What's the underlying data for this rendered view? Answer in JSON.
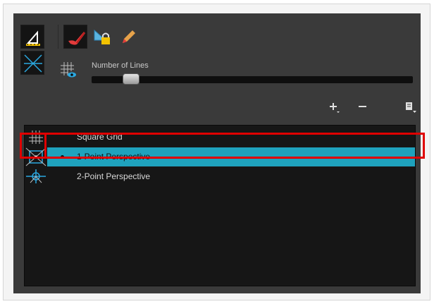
{
  "panel": {
    "accent_color": "#1fa2bd",
    "highlight_color": "#e00000",
    "tools": [
      {
        "name": "perspective-tool-icon",
        "selected": true
      },
      {
        "name": "brush-icon",
        "selected": true
      },
      {
        "name": "lock-ruler-icon",
        "selected": false
      },
      {
        "name": "pencil-icon",
        "selected": false
      },
      {
        "name": "vanishing-point-icon",
        "selected": true
      },
      {
        "name": "grid-visibility-icon",
        "selected": false
      }
    ],
    "slider": {
      "label": "Number of Lines",
      "value_fraction": 0.1
    },
    "actions": {
      "add": "+",
      "remove": "−",
      "menu": "menu-icon"
    }
  },
  "guides": [
    {
      "label": "Square Grid",
      "icon": "square-grid-icon",
      "selected": false,
      "active": false
    },
    {
      "label": "1-Point Perspective",
      "icon": "one-point-perspective-icon",
      "selected": true,
      "active": true
    },
    {
      "label": "2-Point Perspective",
      "icon": "two-point-perspective-icon",
      "selected": false,
      "active": false
    }
  ]
}
